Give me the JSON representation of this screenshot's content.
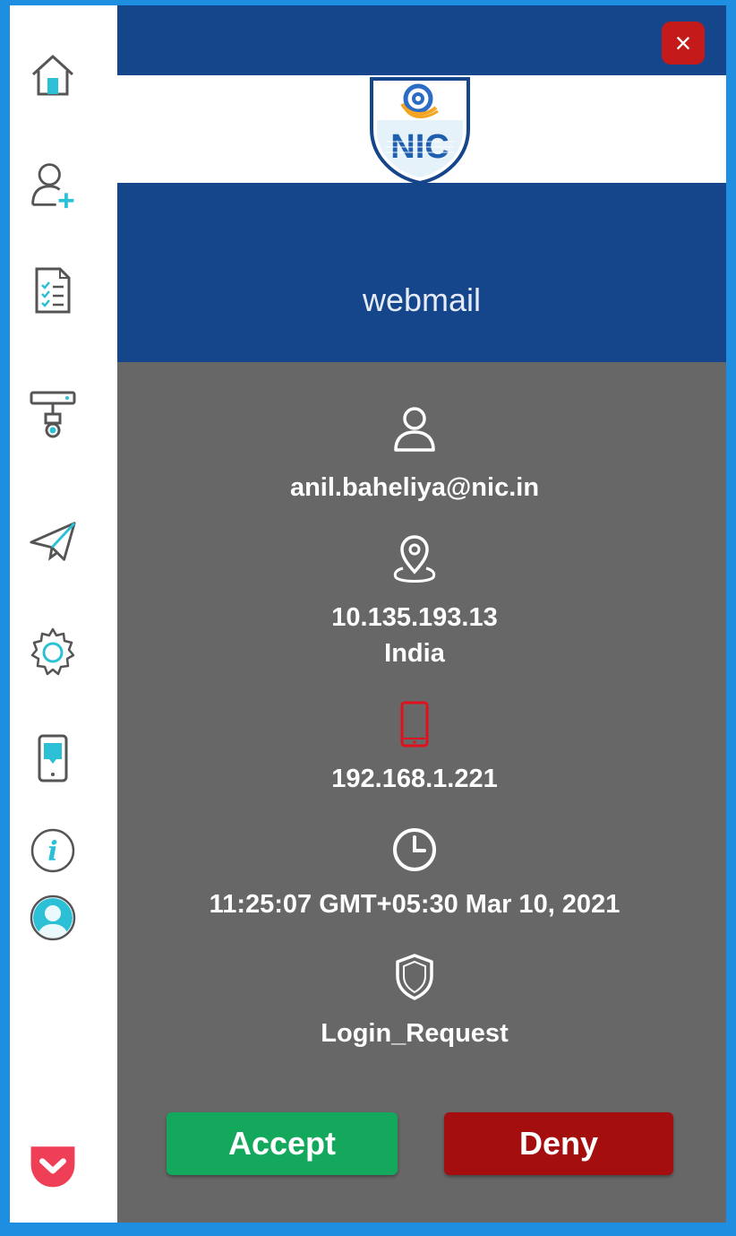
{
  "app": {
    "name": "webmail",
    "logo_text": "NIC",
    "logo_symbol": "@"
  },
  "colors": {
    "header_blue": "#15458b",
    "panel_gray": "#676767",
    "accent_teal": "#2bc0d6",
    "accept_green": "#14a85c",
    "deny_red": "#a50e0e",
    "phone_red": "#e0101e"
  },
  "sidebar": {
    "items": [
      {
        "icon": "home-icon"
      },
      {
        "icon": "add-user-icon"
      },
      {
        "icon": "document-list-icon"
      },
      {
        "icon": "device-connect-icon"
      },
      {
        "icon": "send-icon"
      },
      {
        "icon": "settings-gear-icon"
      },
      {
        "icon": "mobile-device-icon"
      },
      {
        "icon": "info-icon"
      },
      {
        "icon": "profile-icon"
      },
      {
        "icon": "pocket-icon"
      }
    ]
  },
  "request": {
    "email": "anil.baheliya@nic.in",
    "ip": "10.135.193.13",
    "country": "India",
    "device_ip": "192.168.1.221",
    "time": "11:25:07 GMT+05:30 Mar 10, 2021",
    "type": "Login_Request"
  },
  "actions": {
    "accept": "Accept",
    "deny": "Deny",
    "close": "×"
  }
}
